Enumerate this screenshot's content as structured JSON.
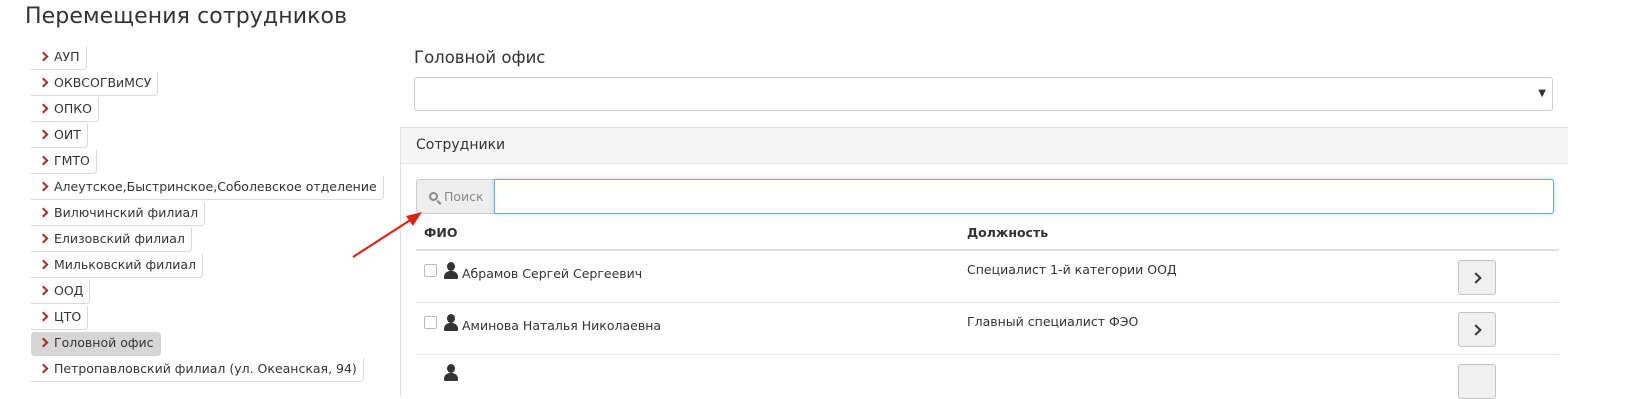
{
  "page": {
    "title": "Перемещения сотрудников"
  },
  "sidebar": {
    "items": [
      {
        "label": "АУП",
        "active": false
      },
      {
        "label": "ОКВСОГВиМСУ",
        "active": false
      },
      {
        "label": "ОПКО",
        "active": false
      },
      {
        "label": "ОИТ",
        "active": false
      },
      {
        "label": "ГМТО",
        "active": false
      },
      {
        "label": "Алеутское,Быстринское,Соболевское отделение",
        "active": false
      },
      {
        "label": "Вилючинский филиал",
        "active": false
      },
      {
        "label": "Елизовский филиал",
        "active": false
      },
      {
        "label": "Мильковский филиал",
        "active": false
      },
      {
        "label": "ООД",
        "active": false
      },
      {
        "label": "ЦТО",
        "active": false
      },
      {
        "label": "Головной офис",
        "active": true
      },
      {
        "label": "Петропавловский филиал (ул. Океанская, 94)",
        "active": false
      }
    ]
  },
  "office": {
    "label": "Головной офис",
    "selected": ""
  },
  "employees": {
    "panel_title": "Сотрудники",
    "search": {
      "addon_label": "Поиск",
      "value": ""
    },
    "columns": {
      "fio": "ФИО",
      "position": "Должность"
    },
    "rows": [
      {
        "fio": "Абрамов Сергей Сергеевич",
        "position": "Специалист 1-й категории ООД"
      },
      {
        "fio": "Аминова Наталья Николаевна",
        "position": "Главный специалист ФЭО"
      }
    ]
  },
  "colors": {
    "accent": "#a52a2a",
    "focus": "#66afe9",
    "annotation": "#d9261c"
  },
  "icons": {
    "sidebar_chevron": "chevron-right-icon",
    "search": "search-icon",
    "user": "user-icon",
    "row_action": "chevron-right-icon"
  }
}
